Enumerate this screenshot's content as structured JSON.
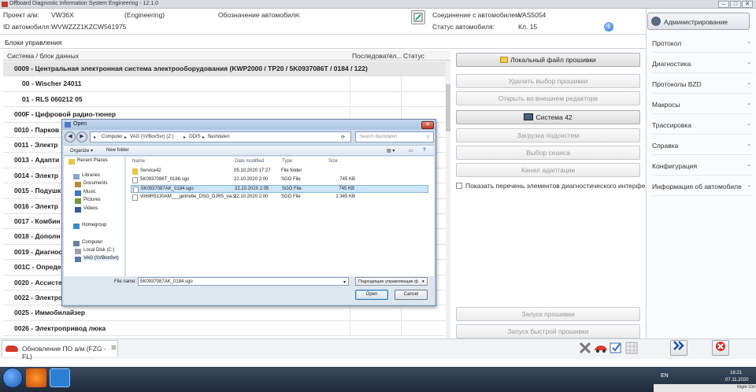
{
  "window": {
    "title": "Offboard Diagnostic Information System Engineering - 12.1.0"
  },
  "info": {
    "project_label": "Проект а/м:",
    "project_value": "VW36X",
    "mode": "(Engineering)",
    "vehicle_name_label": "Обозначение автомобиля:",
    "vin_label": "ID автомобиля:",
    "vin_value": "WVWZZZ1KZCW561975",
    "connection_label": "Соединение с автомобилем:",
    "connection_value": "VAS5054",
    "status_label": "Статус автомобиля:",
    "status_value": "Кл. 15"
  },
  "main": {
    "section_title": "Блоки управления",
    "columns": [
      "Система / блок данных",
      "Последовател...",
      "Статус"
    ],
    "rows": [
      "0009 - Центральная электронная система электрооборудования  (KWP2000 / TP20 / 5K0937086T / 0184 / 122)",
      "00 - Wischer 24011",
      "01 - RLS 060212 05",
      "000F - Цифровой радио-тюнер",
      "0010 - Парков",
      "0011 - Электр",
      "0013 - Адапти",
      "0014 - Электр",
      "0015 - Подушк",
      "0016 - Электр",
      "0017 - Комбин",
      "0018 - Дополн",
      "0019 - Диагнос",
      "001C - Опреде",
      "0020 - Ассисте",
      "0022 - Электро",
      "0025 - Иммобилайзер",
      "0026 - Электропривод люка"
    ]
  },
  "actions": {
    "local_file": "Локальный файл прошивки",
    "clear_selection": "Удалить выбор прошивки",
    "open_external": "Открыть во внешнем редакторе",
    "system42": "Система 42",
    "load_subsystem": "Загрузка подсистем",
    "session_select": "Выбор сеанса",
    "adaptation_channel": "Канал адаптации",
    "show_interface_list": "Показать перечень элементов диагностического интерфейса",
    "start_flash": "Запуск прошивки",
    "start_quick_flash": "Запуск быстрой прошивки"
  },
  "sidebar": {
    "admin": "Администрирование",
    "items": [
      "Протокол",
      "Диагностика",
      "Протоколы BZD",
      "Макросы",
      "Трассировка",
      "Справка",
      "Конфигурация",
      "Информация об автомобиле"
    ]
  },
  "bottom": {
    "tab_label": "Обновление ПО а/м (FZG - FL)"
  },
  "dialog": {
    "title": "Open",
    "path": [
      "Computer",
      "VAG (\\\\VBoxSvr) (Z:)",
      "ODIS",
      "flashdaten"
    ],
    "search_placeholder": "Search flashdaten",
    "organize": "Organize ▾",
    "new_folder": "New folder",
    "nav": [
      "Recent Places",
      "Libraries",
      "Documents",
      "Music",
      "Pictures",
      "Videos",
      "Homegroup",
      "Computer",
      "Local Disk (C:)",
      "VAG (\\\\VBoxSvr)"
    ],
    "columns": [
      "Name",
      "Date modified",
      "Type",
      "Size"
    ],
    "files": [
      {
        "name": "Service42",
        "date": "05.10.2020 17:27",
        "type": "File folder",
        "size": ""
      },
      {
        "name": "5K0937086T_0186.sgo",
        "date": "22.10.2020 2:00",
        "type": "SGO File",
        "size": "745 KB"
      },
      {
        "name": "5K0937087AK_0184.sgo",
        "date": "22.10.2020 2:05",
        "type": "SGO File",
        "size": "745 KB"
      },
      {
        "name": "v069R5130AM___getriebe_DSG_DJR5_sw.s...",
        "date": "22.10.2020 2:00",
        "type": "SGO File",
        "size": "1 345 KB"
      }
    ],
    "filename_label": "File name:",
    "filename_value": "5K0937087AK_0184.sgo",
    "filetype": "Подходящие управляющие ф",
    "open": "Open",
    "cancel": "Cancel"
  },
  "taskbar": {
    "lang": "EN",
    "time": "16:21",
    "date": "07.11.2020",
    "host_key": "Right Ctrl"
  }
}
